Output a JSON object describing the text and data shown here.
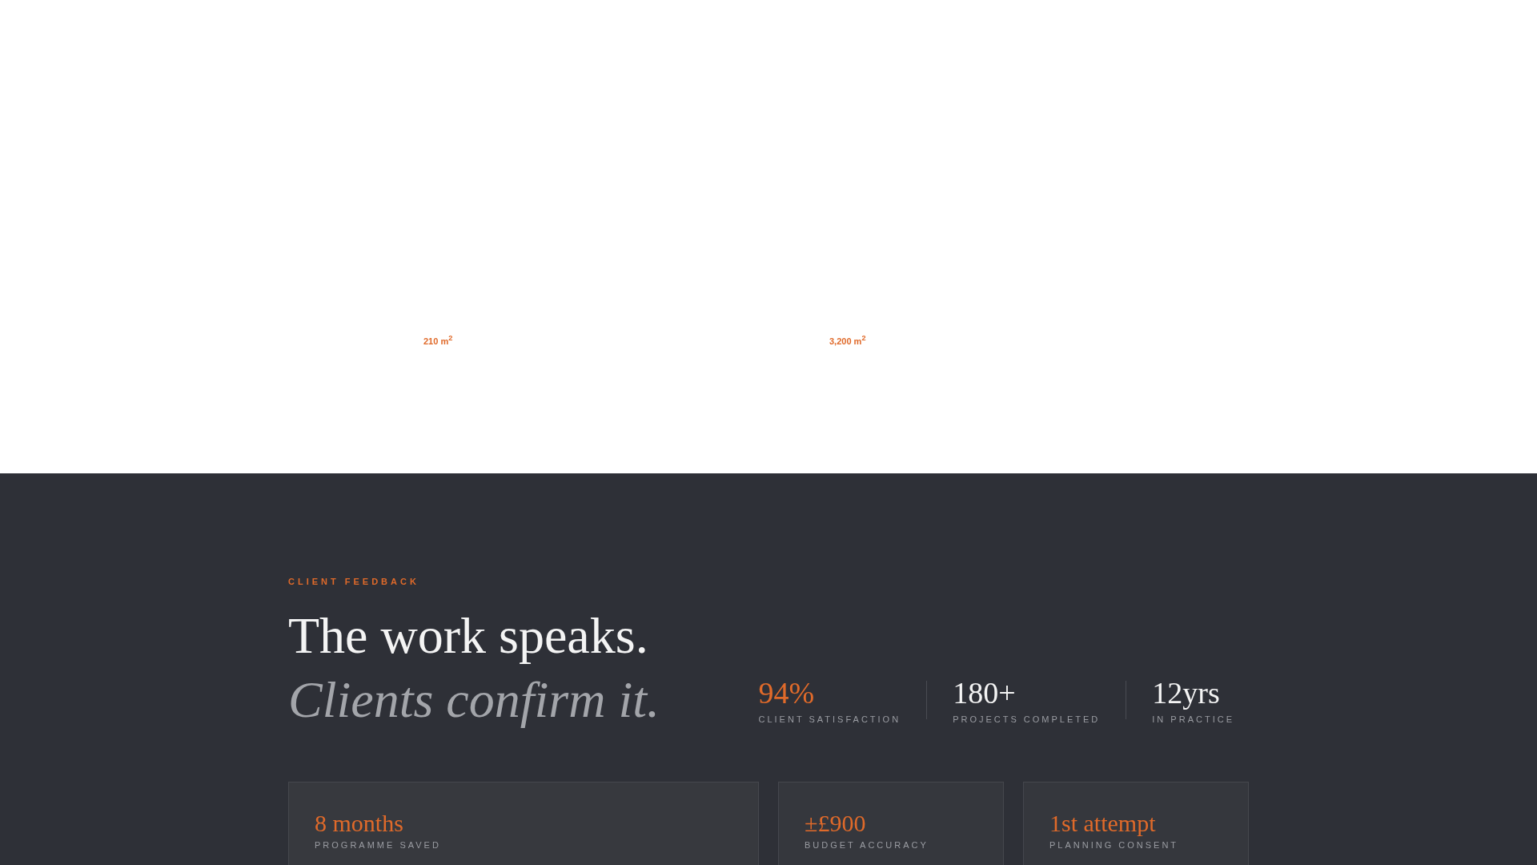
{
  "project_areas": [
    "210 m$^{2}$",
    "3,200 m$^{2}$"
  ],
  "feedback": {
    "eyebrow": "CLIENT FEEDBACK",
    "headline": "The work speaks.",
    "headline_italic": "Clients confirm it.",
    "stats": [
      {
        "value": "94%",
        "label": "CLIENT SATISFACTION",
        "highlight": true
      },
      {
        "value": "180+",
        "label": "PROJECTS COMPLETED",
        "highlight": false
      },
      {
        "value": "12yrs",
        "label": "IN PRACTICE",
        "highlight": false
      }
    ],
    "cards": [
      {
        "value": "8 months",
        "label": "PROGRAMME SAVED"
      },
      {
        "value": "±£900",
        "label": "BUDGET ACCURACY"
      },
      {
        "value": "1st attempt",
        "label": "PLANNING CONSENT"
      }
    ]
  }
}
